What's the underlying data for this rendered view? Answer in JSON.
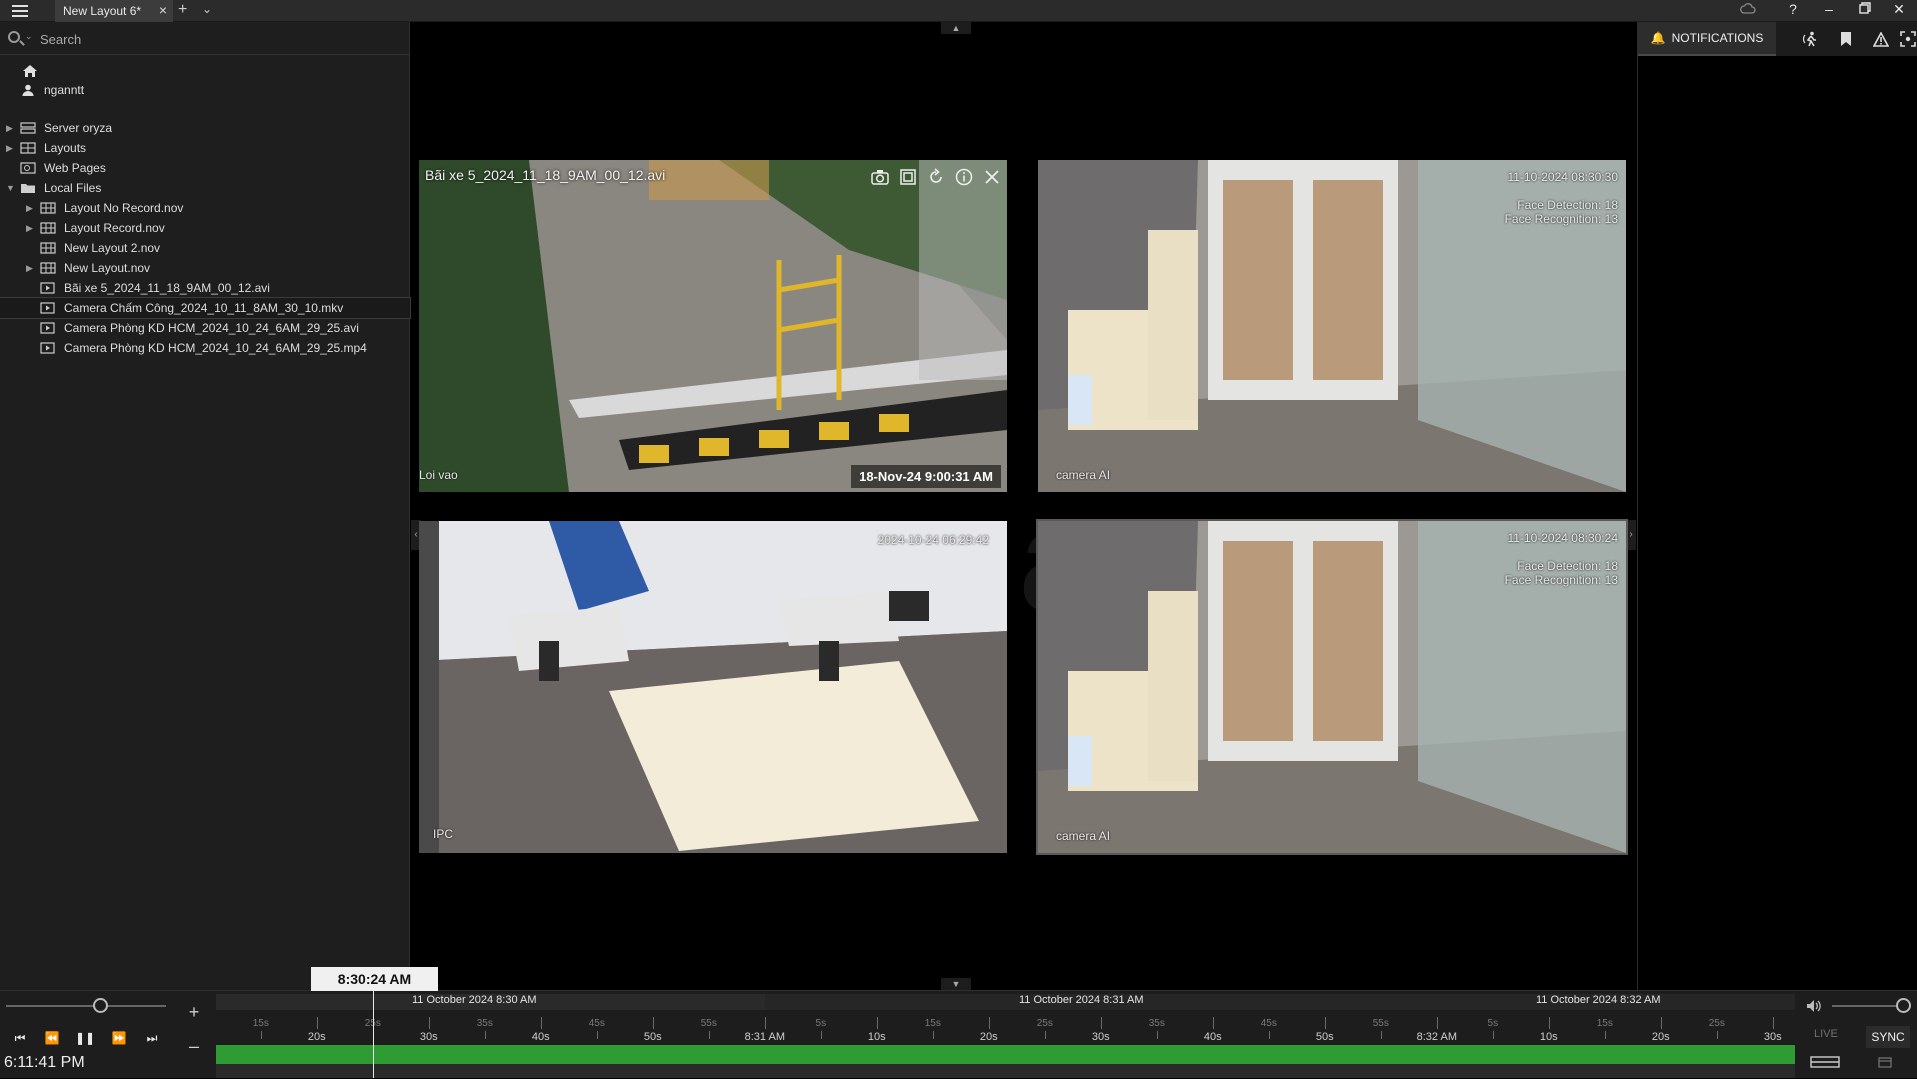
{
  "tab": {
    "title": "New Layout 6*"
  },
  "search": {
    "placeholder": "Search"
  },
  "user": {
    "name": "nganntt"
  },
  "tree": [
    {
      "label": "Server oryza",
      "level": 0,
      "arrow": "right",
      "icon": "server-icon"
    },
    {
      "label": "Layouts",
      "level": 0,
      "arrow": "right",
      "icon": "layouts-icon"
    },
    {
      "label": "Web Pages",
      "level": 0,
      "arrow": "",
      "icon": "webpage-icon"
    },
    {
      "label": "Local Files",
      "level": 0,
      "arrow": "down",
      "icon": "folder-icon"
    },
    {
      "label": "Layout No Record.nov",
      "level": 1,
      "arrow": "right",
      "icon": "layout-file-icon"
    },
    {
      "label": "Layout Record.nov",
      "level": 1,
      "arrow": "right",
      "icon": "layout-file-icon"
    },
    {
      "label": "New Layout 2.nov",
      "level": 1,
      "arrow": "",
      "icon": "layout-file-icon"
    },
    {
      "label": "New Layout.nov",
      "level": 1,
      "arrow": "right",
      "icon": "layout-file-icon"
    },
    {
      "label": "Bãi xe 5_2024_11_18_9AM_00_12.avi",
      "level": 1,
      "arrow": "",
      "icon": "video-file-icon"
    },
    {
      "label": "Camera Chấm Công_2024_10_11_8AM_30_10.mkv",
      "level": 1,
      "arrow": "",
      "icon": "video-file-icon",
      "selected": true
    },
    {
      "label": "Camera Phòng KD HCM_2024_10_24_6AM_29_25.avi",
      "level": 1,
      "arrow": "",
      "icon": "video-file-icon"
    },
    {
      "label": "Camera Phòng KD HCM_2024_10_24_6AM_29_25.mp4",
      "level": 1,
      "arrow": "",
      "icon": "video-file-icon"
    }
  ],
  "cameras": {
    "cam1": {
      "title": "Bãi xe 5_2024_11_18_9AM_00_12.avi",
      "corner_label": "Loi vao",
      "stamp": "18-Nov-24 9:00:31 AM"
    },
    "cam2": {
      "osd_time": "11-10-2024 08:30:30",
      "osd_line1": "Face Detection: 18",
      "osd_line2": "Face Recognition: 13",
      "corner_label": "camera AI"
    },
    "cam3": {
      "osd_time": "2024-10-24 06:29:42",
      "corner_label": "IPC"
    },
    "cam4": {
      "osd_time": "11-10-2024 08:30:24",
      "osd_line1": "Face Detection: 18",
      "osd_line2": "Face Recognition: 13",
      "corner_label": "camera AI"
    }
  },
  "notifications": {
    "label": "NOTIFICATIONS"
  },
  "timeline": {
    "current_time": "6:11:41 PM",
    "cursor_time": "8:30:24 AM",
    "live_label": "LIVE",
    "sync_label": "SYNC",
    "date_labels": [
      "11 October 2024 8:30 AM",
      "11 October 2024 8:31 AM",
      "11 October 2024 8:32 AM"
    ],
    "major_labels": [
      "20s",
      "30s",
      "40s",
      "50s",
      "8:31 AM",
      "10s",
      "20s",
      "30s",
      "40s",
      "50s",
      "8:32 AM",
      "10s",
      "20s",
      "30s"
    ],
    "minor_labels": [
      "15s",
      "25s",
      "35s",
      "45s",
      "55s",
      "5s",
      "15s",
      "25s",
      "35s",
      "45s",
      "55s",
      "5s",
      "15s",
      "25s"
    ]
  },
  "colors": {
    "recording": "#2e9b33",
    "accent": "#f0f0f0"
  }
}
